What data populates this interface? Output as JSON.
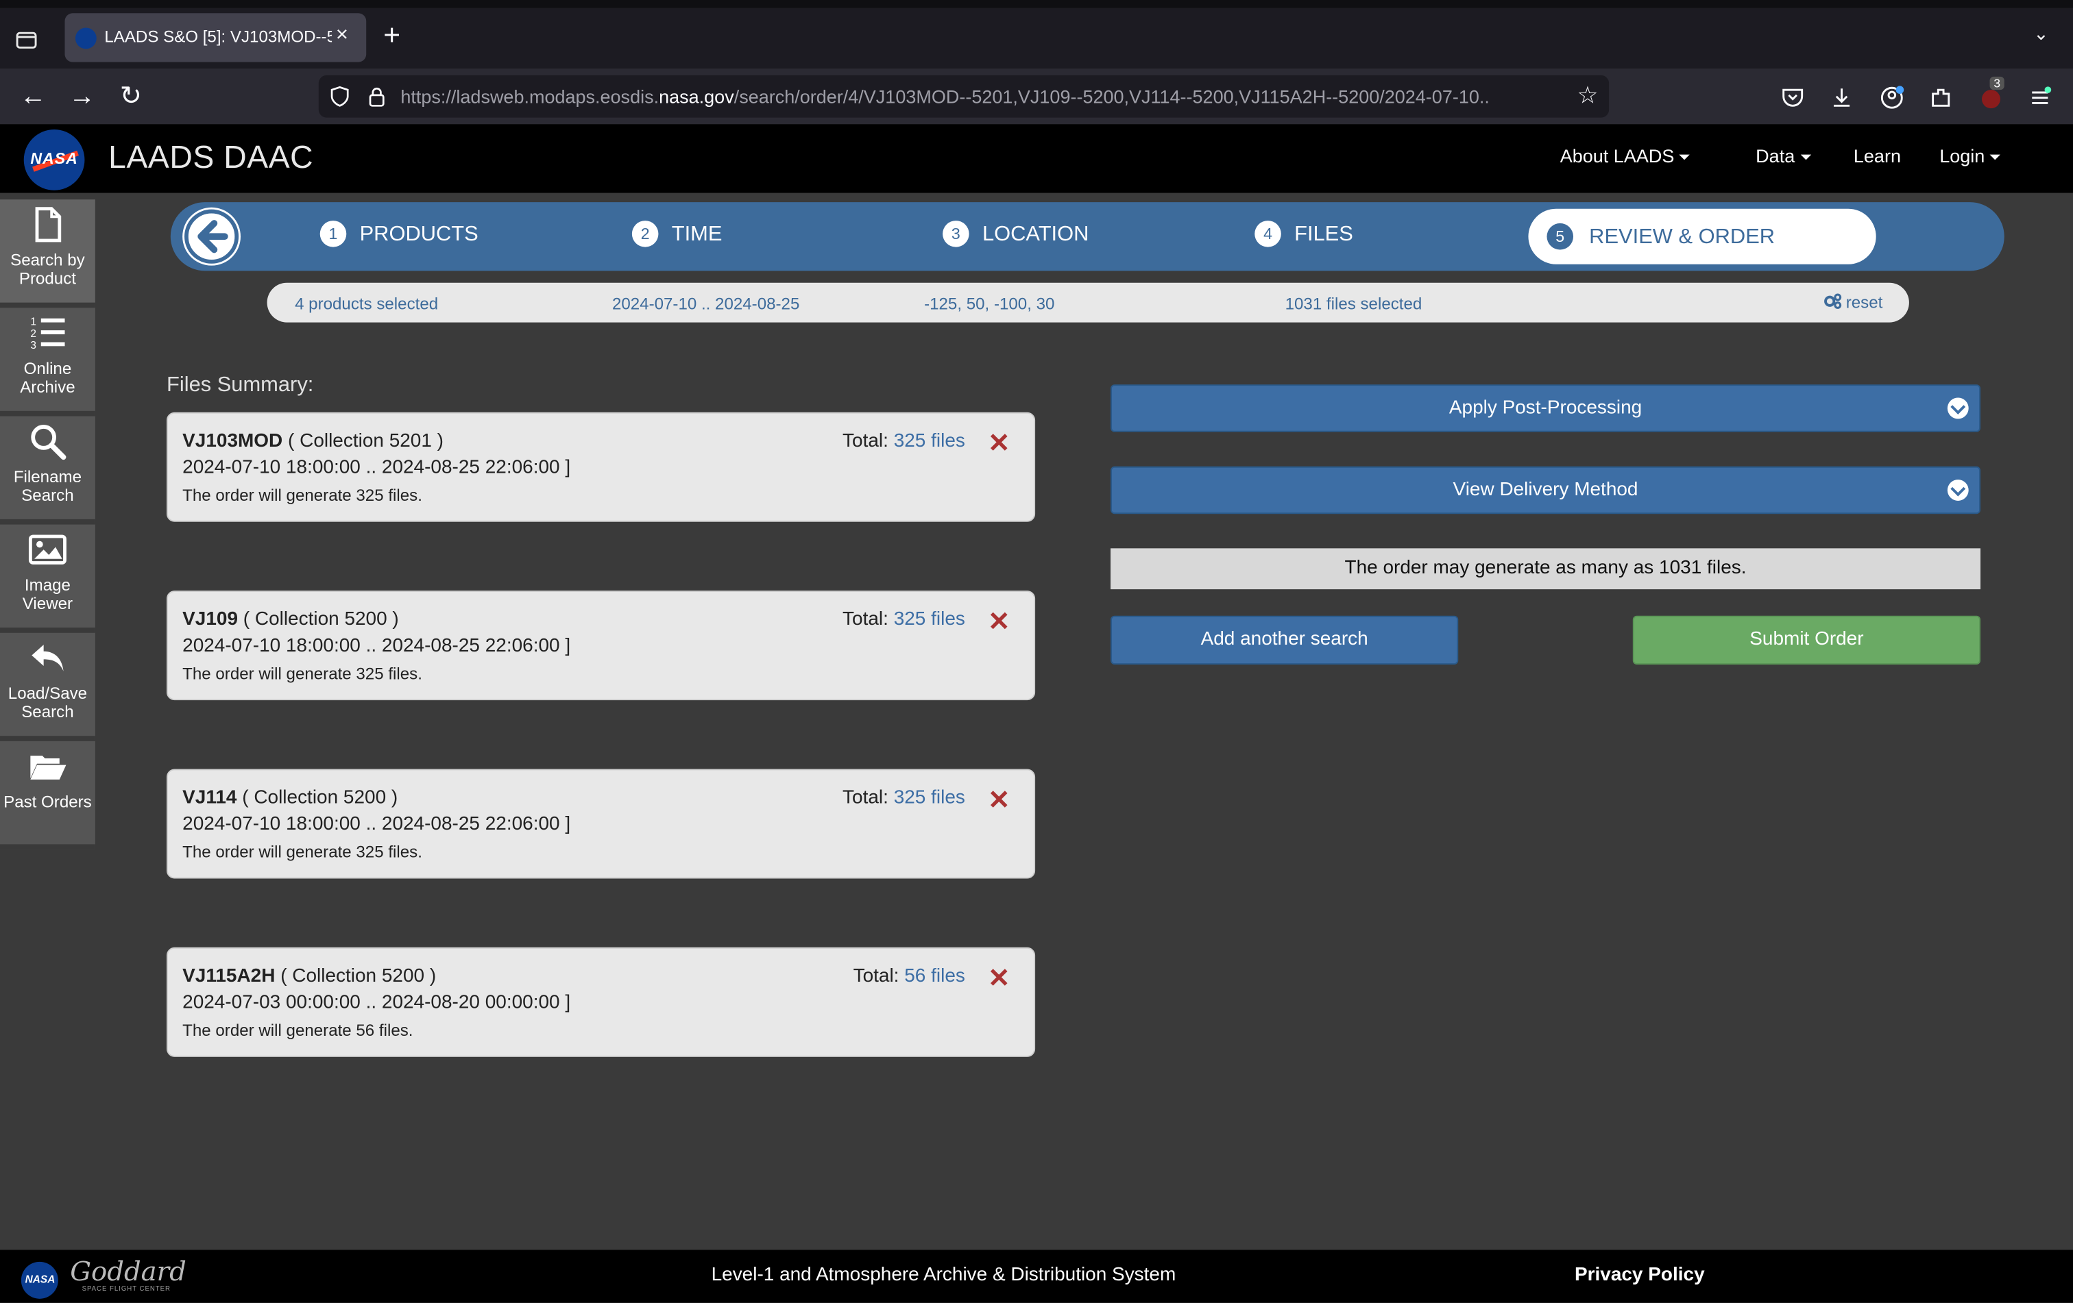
{
  "browser": {
    "tab_title": "LAADS S&O [5]: VJ103MOD--5",
    "url_prefix": "https://ladsweb.modaps.eosdis.",
    "url_domain": "nasa.gov",
    "url_suffix": "/search/order/4/VJ103MOD--5201,VJ109--5200,VJ114--5200,VJ115A2H--5200/2024-07-10..",
    "notification_count": "3"
  },
  "header": {
    "site_title": "LAADS DAAC",
    "logo_text": "NASA",
    "nav": [
      "About LAADS",
      "Data",
      "Learn",
      "Login"
    ]
  },
  "sidebar": {
    "items": [
      {
        "label": "Search by Product",
        "icon": "document-icon"
      },
      {
        "label": "Online Archive",
        "icon": "numbered-list-icon"
      },
      {
        "label": "Filename Search",
        "icon": "magnifier-icon"
      },
      {
        "label": "Image Viewer",
        "icon": "image-icon"
      },
      {
        "label": "Load/Save Search",
        "icon": "reply-arrow-icon"
      },
      {
        "label": "Past Orders",
        "icon": "folder-open-icon"
      }
    ]
  },
  "stepper": {
    "steps": [
      {
        "num": "1",
        "label": "PRODUCTS"
      },
      {
        "num": "2",
        "label": "TIME"
      },
      {
        "num": "3",
        "label": "LOCATION"
      },
      {
        "num": "4",
        "label": "FILES"
      },
      {
        "num": "5",
        "label": "REVIEW & ORDER"
      }
    ],
    "active_step": 5
  },
  "summary": {
    "products": "4 products selected",
    "dates": "2024-07-10 .. 2024-08-25",
    "location": "-125, 50, -100, 30",
    "files": "1031 files selected",
    "reset": "reset"
  },
  "files_summary": {
    "title": "Files Summary:",
    "total_label": "Total:",
    "items": [
      {
        "product": "VJ103MOD",
        "collection": "( Collection 5201 )",
        "range": "2024-07-10 18:00:00 .. 2024-08-25 22:06:00 ]",
        "note": "The order will generate 325 files.",
        "total": "325 files"
      },
      {
        "product": "VJ109",
        "collection": "( Collection 5200 )",
        "range": "2024-07-10 18:00:00 .. 2024-08-25 22:06:00 ]",
        "note": "The order will generate 325 files.",
        "total": "325 files"
      },
      {
        "product": "VJ114",
        "collection": "( Collection 5200 )",
        "range": "2024-07-10 18:00:00 .. 2024-08-25 22:06:00 ]",
        "note": "The order will generate 325 files.",
        "total": "325 files"
      },
      {
        "product": "VJ115A2H",
        "collection": "( Collection 5200 )",
        "range": "2024-07-03 00:00:00 .. 2024-08-20 00:00:00 ]",
        "note": "The order will generate 56 files.",
        "total": "56 files"
      }
    ]
  },
  "order": {
    "post_processing": "Apply Post-Processing",
    "delivery": "View Delivery Method",
    "may_generate": "The order may generate as many as 1031 files.",
    "add_search": "Add another search",
    "submit": "Submit Order"
  },
  "footer": {
    "logo_text": "NASA",
    "goddard": "Goddard",
    "goddard_sub": "SPACE FLIGHT CENTER",
    "center_text": "Level-1 and Atmosphere Archive & Distribution System",
    "privacy": "Privacy Policy"
  },
  "colors": {
    "accent_blue": "#3d6b9b",
    "submit_green": "#6aaa64",
    "delete_red": "#aa3333"
  }
}
